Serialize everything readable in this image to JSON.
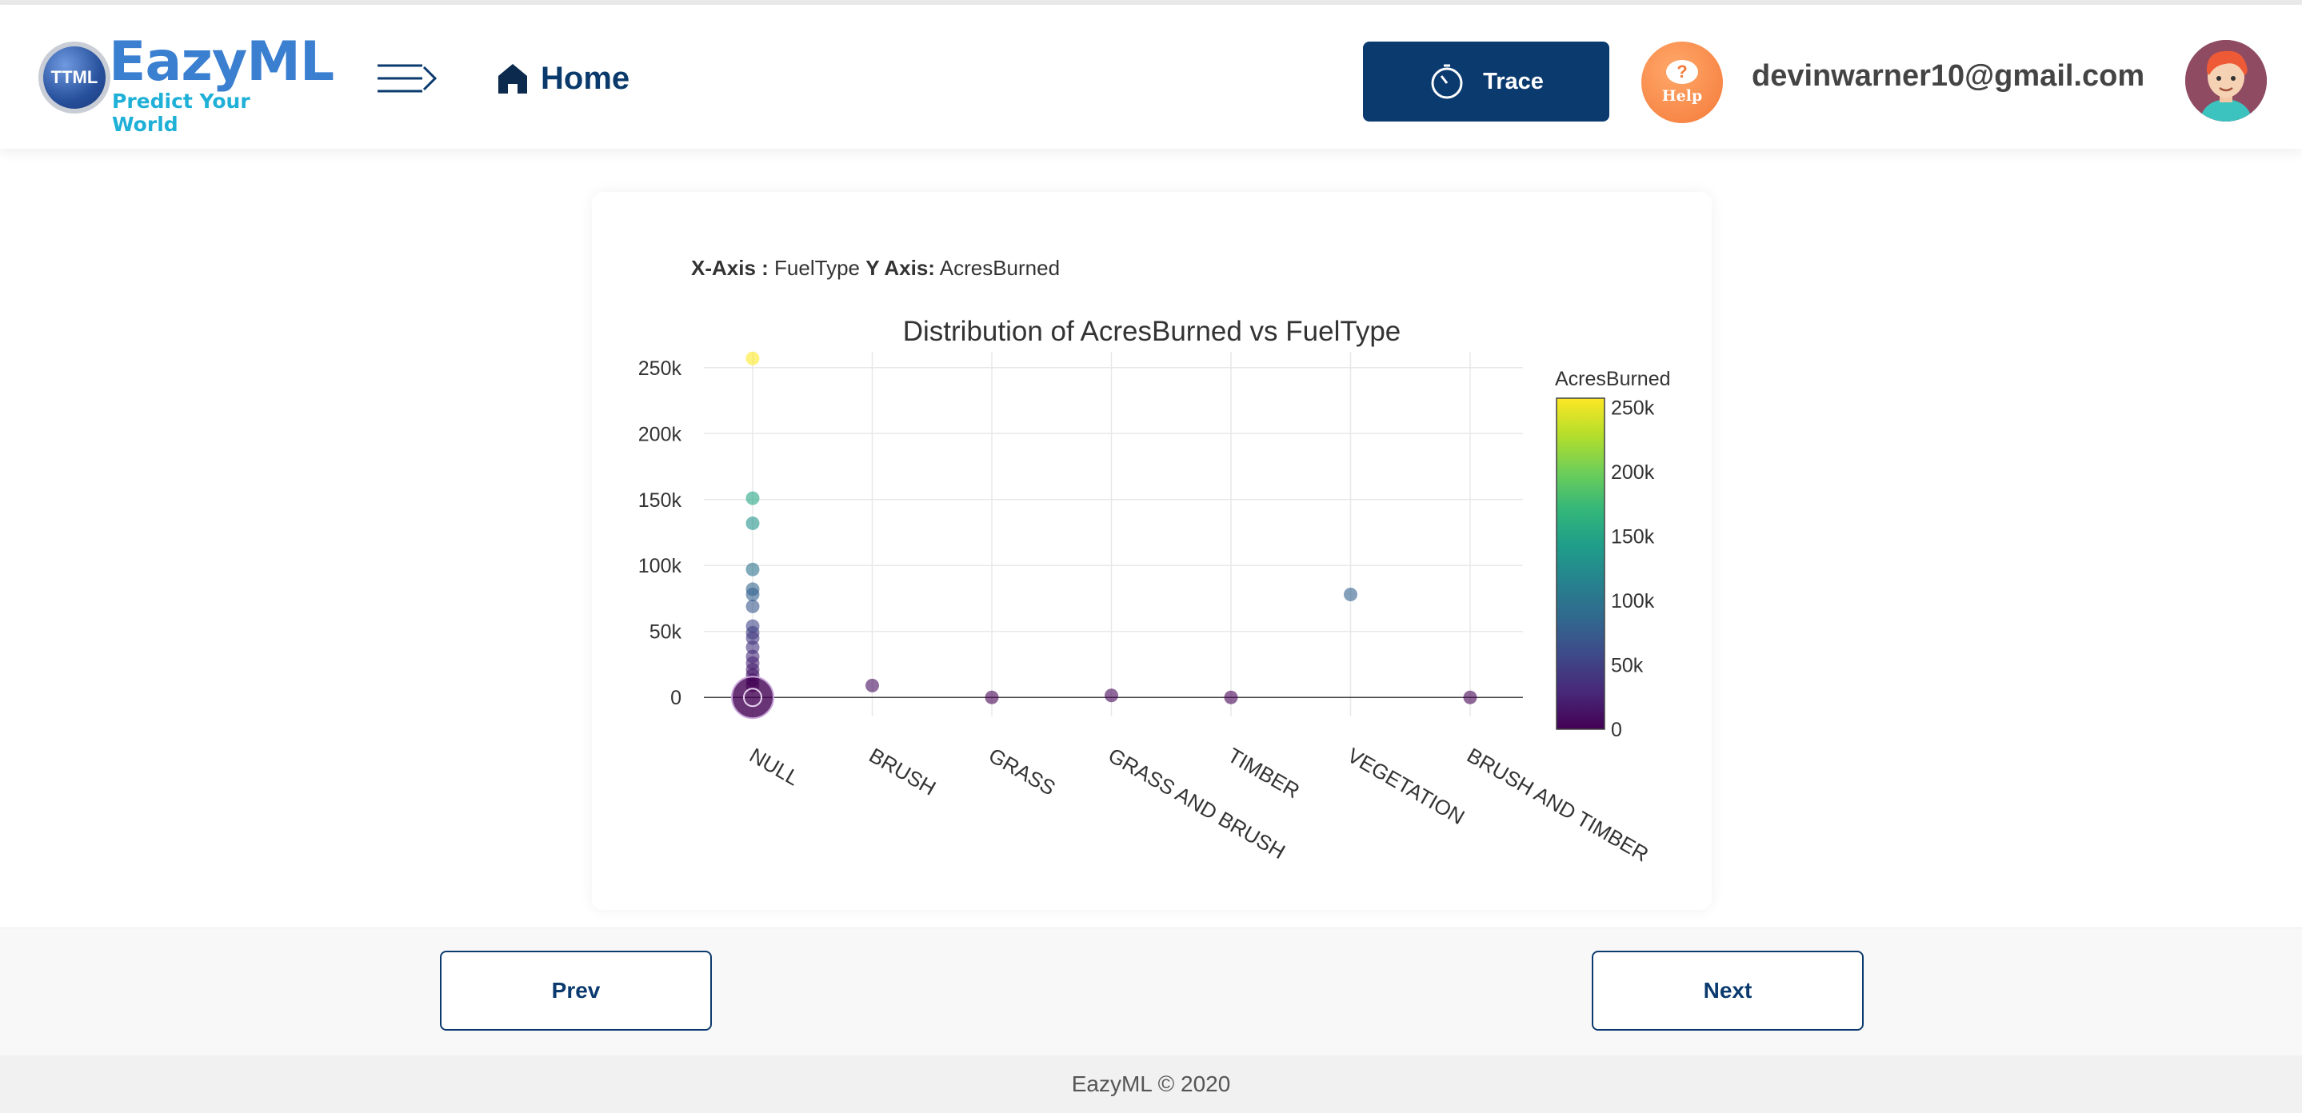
{
  "header": {
    "logo": {
      "badge": "TTML",
      "name": "EazyML",
      "tagline": "Predict Your World"
    },
    "menu_icon": "hamburger-arrow-icon",
    "home": {
      "icon": "home-icon",
      "label": "Home"
    },
    "trace": {
      "icon": "stopwatch-icon",
      "label": "Trace",
      "color": "#0b3a6e"
    },
    "help": {
      "icon": "chat-bubble-icon",
      "label": "Help",
      "color": "#f47a39"
    },
    "user": {
      "email": "devinwarner10@gmail.com",
      "avatar": "avatar"
    }
  },
  "card": {
    "x_axis_label": "X-Axis :",
    "x_axis_value": "FuelType",
    "y_axis_label": "Y Axis:",
    "y_axis_value": "AcresBurned"
  },
  "chart_data": {
    "type": "scatter",
    "title": "Distribution of AcresBurned vs FuelType",
    "xlabel": "",
    "ylabel": "",
    "categories": [
      "NULL",
      "BRUSH",
      "GRASS",
      "GRASS AND BRUSH",
      "TIMBER",
      "VEGETATION",
      "BRUSH AND TIMBER"
    ],
    "ylim": [
      -12000,
      262000
    ],
    "y_ticks": [
      0,
      50000,
      100000,
      150000,
      200000,
      250000
    ],
    "y_tick_labels": [
      "0",
      "50k",
      "100k",
      "150k",
      "200k",
      "250k"
    ],
    "grid": true,
    "colorscale": "viridis",
    "colorbar": {
      "title": "AcresBurned",
      "range": [
        0,
        257000
      ],
      "ticks": [
        0,
        50000,
        100000,
        150000,
        200000,
        250000
      ],
      "tick_labels": [
        "0",
        "50k",
        "100k",
        "150k",
        "200k",
        "250k"
      ]
    },
    "points": [
      {
        "x": "NULL",
        "y": 257000
      },
      {
        "x": "NULL",
        "y": 151000
      },
      {
        "x": "NULL",
        "y": 132000
      },
      {
        "x": "NULL",
        "y": 97000
      },
      {
        "x": "NULL",
        "y": 82000
      },
      {
        "x": "NULL",
        "y": 78000
      },
      {
        "x": "NULL",
        "y": 69000
      },
      {
        "x": "NULL",
        "y": 54000
      },
      {
        "x": "NULL",
        "y": 49000
      },
      {
        "x": "NULL",
        "y": 45000
      },
      {
        "x": "NULL",
        "y": 38000
      },
      {
        "x": "NULL",
        "y": 31000
      },
      {
        "x": "NULL",
        "y": 26000
      },
      {
        "x": "NULL",
        "y": 21000
      },
      {
        "x": "NULL",
        "y": 17000
      },
      {
        "x": "NULL",
        "y": 13000
      },
      {
        "x": "NULL",
        "y": 9000
      },
      {
        "x": "NULL",
        "y": 0
      },
      {
        "x": "BRUSH",
        "y": 9000
      },
      {
        "x": "GRASS",
        "y": 0
      },
      {
        "x": "GRASS AND BRUSH",
        "y": 1500
      },
      {
        "x": "TIMBER",
        "y": 0
      },
      {
        "x": "VEGETATION",
        "y": 78000
      },
      {
        "x": "BRUSH AND TIMBER",
        "y": 0
      }
    ]
  },
  "nav": {
    "prev_label": "Prev",
    "next_label": "Next"
  },
  "footer": {
    "copyright": "EazyML © 2020"
  }
}
